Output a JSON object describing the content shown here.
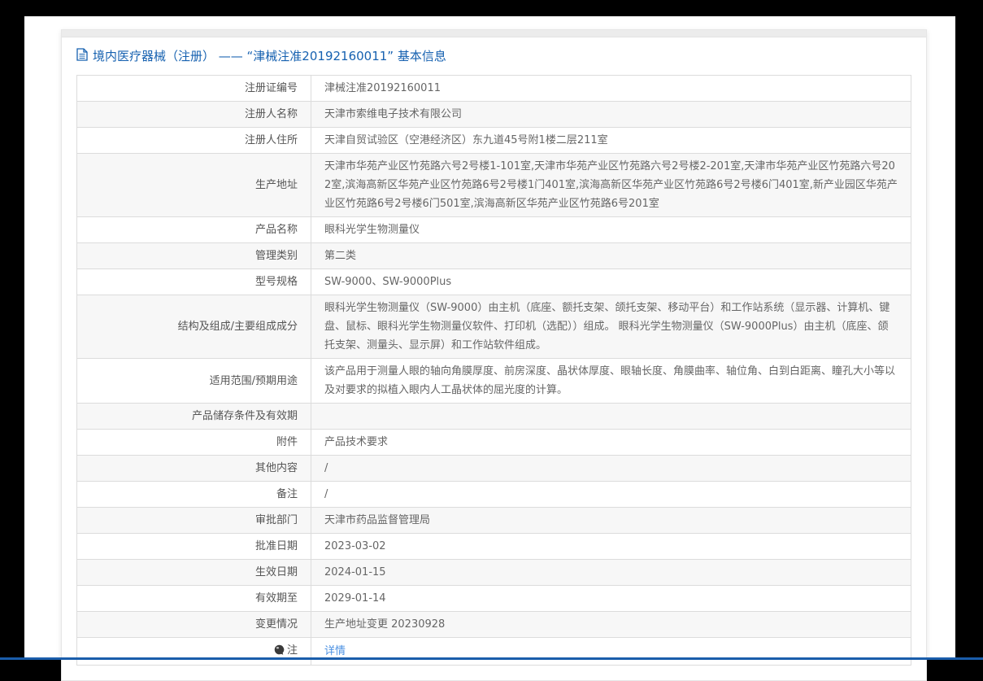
{
  "header": {
    "title": "境内医疗器械（注册） —— “津械注准20192160011” 基本信息",
    "title_icon": "document-icon"
  },
  "table": {
    "rows": [
      {
        "label": "注册证编号",
        "value": "津械注准20192160011"
      },
      {
        "label": "注册人名称",
        "value": "天津市索维电子技术有限公司"
      },
      {
        "label": "注册人住所",
        "value": "天津自贸试验区（空港经济区）东九道45号附1楼二层211室"
      },
      {
        "label": "生产地址",
        "value": "天津市华苑产业区竹苑路六号2号楼1-101室,天津市华苑产业区竹苑路六号2号楼2-201室,天津市华苑产业区竹苑路六号202室,滨海高新区华苑产业区竹苑路6号2号楼1门401室,滨海高新区华苑产业区竹苑路6号2号楼6门401室,新产业园区华苑产业区竹苑路6号2号楼6门501室,滨海高新区华苑产业区竹苑路6号201室"
      },
      {
        "label": "产品名称",
        "value": "眼科光学生物测量仪"
      },
      {
        "label": "管理类别",
        "value": "第二类"
      },
      {
        "label": "型号规格",
        "value": "SW-9000、SW-9000Plus"
      },
      {
        "label": "结构及组成/主要组成成分",
        "value": "眼科光学生物测量仪（SW-9000）由主机（底座、额托支架、颌托支架、移动平台）和工作站系统（显示器、计算机、键盘、鼠标、眼科光学生物测量仪软件、打印机（选配））组成。 眼科光学生物测量仪（SW-9000Plus）由主机（底座、颌托支架、测量头、显示屏）和工作站软件组成。"
      },
      {
        "label": "适用范围/预期用途",
        "value": "该产品用于测量人眼的轴向角膜厚度、前房深度、晶状体厚度、眼轴长度、角膜曲率、轴位角、白到白距离、瞳孔大小等以及对要求的拟植入眼内人工晶状体的屈光度的计算。"
      },
      {
        "label": "产品储存条件及有效期",
        "value": ""
      },
      {
        "label": "附件",
        "value": "产品技术要求"
      },
      {
        "label": "其他内容",
        "value": "/"
      },
      {
        "label": "备注",
        "value": "/"
      },
      {
        "label": "审批部门",
        "value": "天津市药品监督管理局"
      },
      {
        "label": "批准日期",
        "value": "2023-03-02"
      },
      {
        "label": "生效日期",
        "value": "2024-01-15"
      },
      {
        "label": "有效期至",
        "value": "2029-01-14"
      },
      {
        "label": "变更情况",
        "value": "生产地址变更 20230928"
      },
      {
        "label": "注",
        "value": "详情",
        "link": true,
        "icon": "note-icon"
      }
    ]
  },
  "colors": {
    "title_blue": "#1661b0",
    "link_blue": "#4a90e2",
    "row_stripe": "#f7f7f7",
    "table_border": "#dcdcdc",
    "footer_line_blue": "#1a5dab",
    "frame_black": "#000000"
  }
}
